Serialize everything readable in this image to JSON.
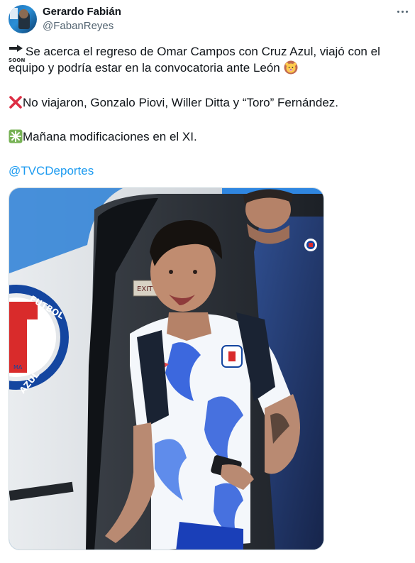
{
  "author": {
    "display_name": "Gerardo Fabián",
    "handle": "@FabanReyes"
  },
  "tweet": {
    "line1_text": "Se acerca el regreso de Omar Campos con Cruz Azul, viajó con el equipo y podría estar en la convocatoria ante León",
    "line1_icon": "soon-arrow-icon",
    "line1_trailing_icon": "lion-face-icon",
    "line2_text": "No viajaron, Gonzalo Piovi, Willer Ditta y “Toro” Fernández.",
    "line2_icon": "cross-mark-icon",
    "line3_text": "Mañana modificaciones en el XI.",
    "line3_icon": "sparkle-icon",
    "mention": "@TVCDeportes",
    "soon_label": "SOON"
  },
  "media": {
    "plane_sign_text": "EXIT",
    "logo_text_top": "FUTBOL",
    "logo_text_bottom": "AZUL",
    "logo_letters": "MA",
    "icon": "photo-player-exiting-plane"
  },
  "colors": {
    "link": "#1d9bf0",
    "secondary_text": "#536471",
    "primary_text": "#0f1419",
    "cross_red": "#dd2e44",
    "sparkle_green": "#77b255",
    "brand_blue": "#1446a0"
  }
}
